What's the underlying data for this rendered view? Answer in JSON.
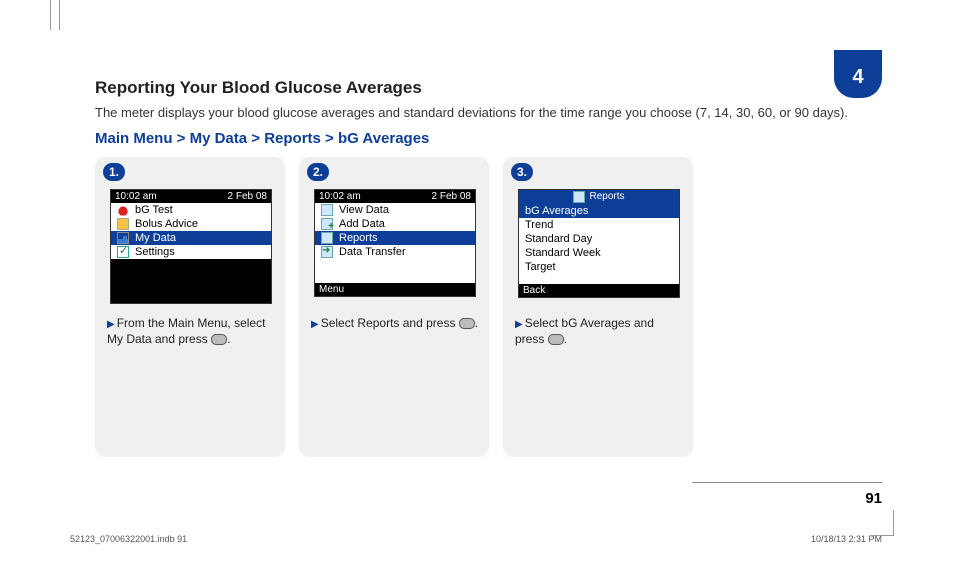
{
  "chapter": "4",
  "section_title": "Reporting Your Blood Glucose Averages",
  "section_text": "The meter displays your blood glucose averages and standard deviations for the time range you choose (7, 14, 30, 60, or 90 days).",
  "breadcrumb": "Main Menu > My Data > Reports > bG Averages",
  "steps": [
    {
      "number": "1.",
      "status_time": "10:02 am",
      "status_date": "2 Feb 08",
      "menu": [
        {
          "icon": "drop",
          "label": "bG Test",
          "selected": false
        },
        {
          "icon": "calc",
          "label": "Bolus Advice",
          "selected": false
        },
        {
          "icon": "chart",
          "label": "My Data",
          "selected": true
        },
        {
          "icon": "check",
          "label": "Settings",
          "selected": false
        }
      ],
      "instruction_pre": "From the Main Menu, select My Data and press",
      "instruction_post": "."
    },
    {
      "number": "2.",
      "status_time": "10:02 am",
      "status_date": "2 Feb 08",
      "menu": [
        {
          "icon": "view",
          "label": "View Data",
          "selected": false
        },
        {
          "icon": "add",
          "label": "Add Data",
          "selected": false
        },
        {
          "icon": "reports",
          "label": "Reports",
          "selected": true
        },
        {
          "icon": "transfer",
          "label": "Data Transfer",
          "selected": false
        }
      ],
      "softkey": "Menu",
      "instruction_pre": "Select Reports and press",
      "instruction_post": "."
    },
    {
      "number": "3.",
      "title_bar": "Reports",
      "menu": [
        {
          "label": "bG Averages",
          "selected": true
        },
        {
          "label": "Trend",
          "selected": false
        },
        {
          "label": "Standard Day",
          "selected": false
        },
        {
          "label": "Standard Week",
          "selected": false
        },
        {
          "label": "Target",
          "selected": false
        }
      ],
      "softkey": "Back",
      "instruction_pre": "Select bG Averages and press",
      "instruction_post": "."
    }
  ],
  "page_number": "91",
  "footer_left": "52123_07006322001.indb   91",
  "footer_right": "10/18/13   2:31 PM"
}
